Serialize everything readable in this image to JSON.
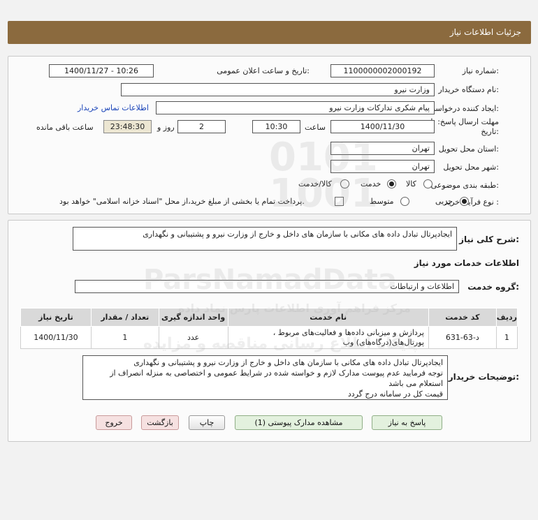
{
  "header": {
    "title": "جزئیات اطلاعات نیاز"
  },
  "form": {
    "need_number_label": "شماره نیاز:",
    "need_number": "1100000002000192",
    "announce_label": "تاریخ و ساعت اعلان عمومی:",
    "announce_value": "1400/11/27 - 10:26",
    "buyer_org_label": "نام دستگاه خریدار:",
    "buyer_org": "وزارت نیرو",
    "creator_label": "ایجاد کننده درخواست:",
    "creator": "پیام شکری تدارکات وزارت نیرو",
    "contact_link": "اطلاعات تماس خریدار",
    "deadline_label_1": "مهلت ارسال پاسخ: تا",
    "deadline_label_2": "تاریخ:",
    "deadline_date": "1400/11/30",
    "time_label": "ساعت",
    "deadline_time": "10:30",
    "days_value": "2",
    "days_label": "روز و",
    "remaining_time": "23:48:30",
    "remaining_label": "ساعت باقی مانده",
    "province_label": "استان محل تحویل:",
    "province": "تهران",
    "city_label": "شهر محل تحویل:",
    "city": "تهران",
    "category_label": "طبقه بندی موضوعی:",
    "category_options": [
      "کالا",
      "خدمت",
      "کالا/خدمت"
    ],
    "category_selected": "خدمت",
    "process_label": "نوع فرآیند خرید :",
    "process_options": [
      "جزیی",
      "متوسط"
    ],
    "process_selected": "جزیی",
    "payment_note": "پرداخت تمام یا بخشی از مبلغ خرید،از محل \"اسناد خزانه اسلامی\" خواهد بود."
  },
  "details": {
    "summary_label": "شرح کلی نیاز:",
    "summary": "ایجادپرتال تبادل داده های مکانی با سازمان های داخل و خارج از وزارت نیرو و پشتیبانی و نگهداری",
    "services_heading": "اطلاعات خدمات مورد نیاز",
    "service_group_label": "گروه خدمت:",
    "service_group": "اطلاعات و ارتباطات",
    "table": {
      "headers": [
        "ردیف",
        "کد خدمت",
        "نام خدمت",
        "واحد اندازه گیری",
        "تعداد / مقدار",
        "تاریخ نیاز"
      ],
      "rows": [
        {
          "row": "1",
          "code": "د-63-631",
          "name": "پردازش و میزبانی داده‌ها و فعالیت‌های مربوط ، پورتال‌های(درگاه‌های) وب",
          "unit": "عدد",
          "qty": "1",
          "date": "1400/11/30"
        }
      ]
    },
    "buyer_notes_label": "توضیحات خریدار:",
    "buyer_notes": "ایجادپرتال تبادل داده های مکانی با سازمان های داخل و خارج از وزارت نیرو و پشتیبانی و نگهداری\nتوجه فرمایید عدم پیوست مدارک لازم و خواسته شده در شرایط عمومی و اختصاصی به منزله انصراف از استعلام می باشد\nقیمت کل در سامانه درج گردد"
  },
  "buttons": {
    "reply": "پاسخ به نیاز",
    "attachments": "مشاهده مدارک پیوستی (1)",
    "print": "چاپ",
    "back": "بازگشت",
    "exit": "خروج"
  },
  "watermark": {
    "line1": "ParsNamadData",
    "line2": "مرکز فراهم آوری اطلاعات پارس نماد داده",
    "line3": "پایگاه اطلاع رسانی مناقصه و مزایده"
  }
}
